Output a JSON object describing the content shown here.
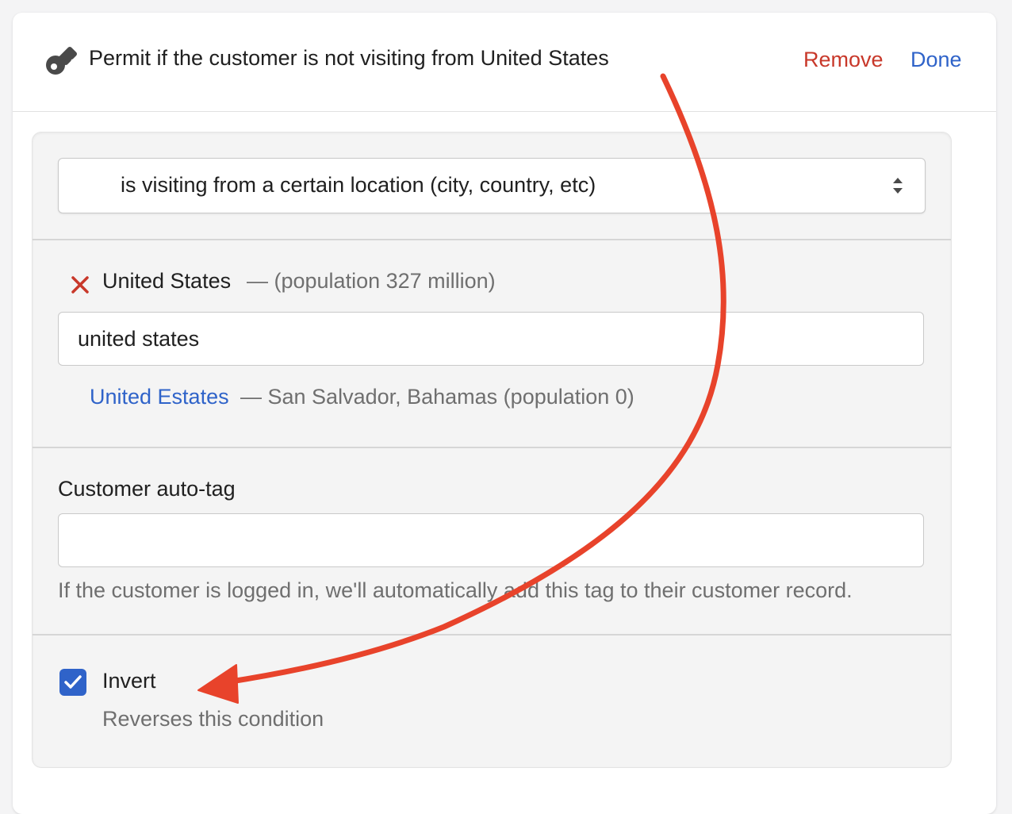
{
  "header": {
    "title": "Permit if the customer is not visiting from United States",
    "remove_label": "Remove",
    "done_label": "Done",
    "icon": "key-icon"
  },
  "condition_select": {
    "value": "is visiting from a certain location (city, country, etc)",
    "icon": "select-arrows-icon"
  },
  "location": {
    "selected_name": "United States",
    "selected_meta": "— (population 327 million)",
    "remove_icon": "close-icon",
    "search_value": "united states",
    "suggestion": {
      "name": "United Estates",
      "meta": "— San Salvador, Bahamas (population 0)"
    }
  },
  "auto_tag": {
    "label": "Customer auto-tag",
    "value": "",
    "help": "If the customer is logged in, we'll automatically add this tag to their customer record."
  },
  "invert": {
    "label": "Invert",
    "description": "Reverses this condition",
    "checked": true
  },
  "colors": {
    "remove": "#c8382a",
    "link": "#2f63c9",
    "checkbox": "#2f63c9",
    "annotation_arrow": "#e8432b"
  }
}
